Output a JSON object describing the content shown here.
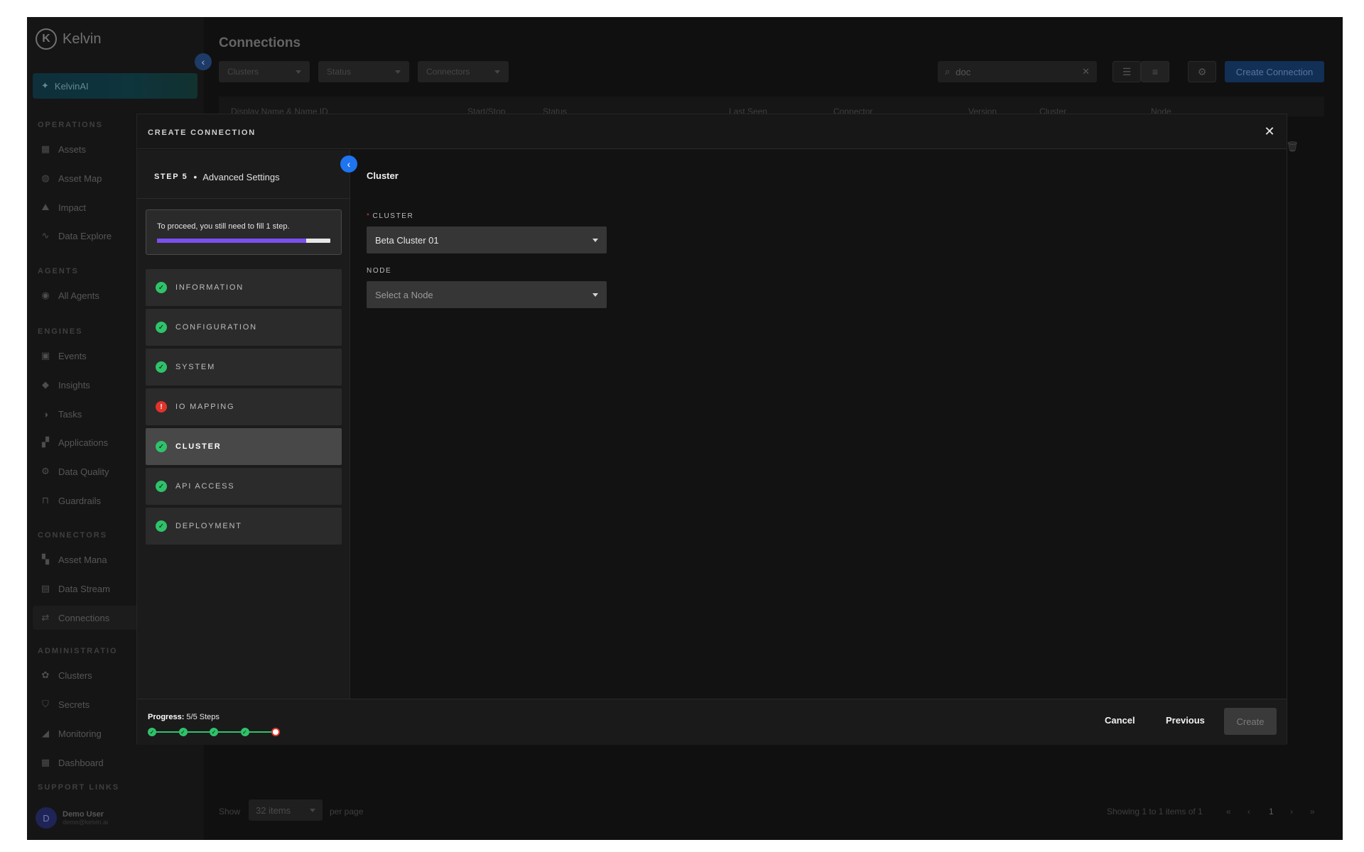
{
  "sidebar": {
    "brand": "Kelvin",
    "kelvinai": "KelvinAI",
    "sections": {
      "operations": "OPERATIONS",
      "agents": "AGENTS",
      "engines": "ENGINES",
      "connectors": "CONNECTORS",
      "administration": "ADMINISTRATIO",
      "support": "SUPPORT LINKS"
    },
    "items": {
      "assets": "Assets",
      "asset_map": "Asset Map",
      "impact": "Impact",
      "data_explorer": "Data Explore",
      "all_agents": "All Agents",
      "events": "Events",
      "insights": "Insights",
      "tasks": "Tasks",
      "applications": "Applications",
      "data_quality": "Data Quality",
      "guardrails": "Guardrails",
      "asset_manager": "Asset Mana",
      "data_streams": "Data Stream",
      "connections": "Connections",
      "clusters": "Clusters",
      "secrets": "Secrets",
      "monitoring": "Monitoring",
      "dashboard": "Dashboard"
    },
    "user": {
      "initial": "D",
      "name": "Demo User",
      "email": "demo@kelvin.ai"
    }
  },
  "page": {
    "title": "Connections",
    "filters": {
      "clusters": "Clusters",
      "status": "Status",
      "connectors": "Connectors"
    },
    "search_value": "doc",
    "create_label": "Create Connection",
    "columns": {
      "name": "Display Name & Name ID",
      "start_stop": "Start/Stop",
      "status": "Status",
      "last_seen": "Last Seen",
      "connector": "Connector",
      "version": "Version",
      "cluster": "Cluster",
      "node": "Node"
    },
    "pager": {
      "show": "Show",
      "per_page_value": "32 items",
      "per_page": "per page",
      "showing": "Showing 1 to 1 items of 1",
      "current_page": "1"
    }
  },
  "modal": {
    "title": "CREATE CONNECTION",
    "step_no": "STEP 5",
    "step_name": "Advanced Settings",
    "proceed_text": "To proceed, you still need to fill 1 step.",
    "proceed_progress": 0.86,
    "steps": [
      {
        "label": "INFORMATION",
        "status": "ok"
      },
      {
        "label": "CONFIGURATION",
        "status": "ok"
      },
      {
        "label": "SYSTEM",
        "status": "ok"
      },
      {
        "label": "IO MAPPING",
        "status": "error"
      },
      {
        "label": "CLUSTER",
        "status": "ok",
        "current": true
      },
      {
        "label": "API ACCESS",
        "status": "ok"
      },
      {
        "label": "DEPLOYMENT",
        "status": "ok"
      }
    ],
    "content": {
      "title": "Cluster",
      "cluster_label": "CLUSTER",
      "cluster_value": "Beta Cluster 01",
      "node_label": "NODE",
      "node_placeholder": "Select a Node"
    },
    "footer": {
      "progress_label": "Progress:",
      "progress_value": "5/5 Steps",
      "cancel": "Cancel",
      "previous": "Previous",
      "create": "Create"
    }
  },
  "colors": {
    "accent_blue": "#1f74f0",
    "success_green": "#2fc26a",
    "error_red": "#e0342b",
    "progress_purple": "#7b4ff0"
  }
}
